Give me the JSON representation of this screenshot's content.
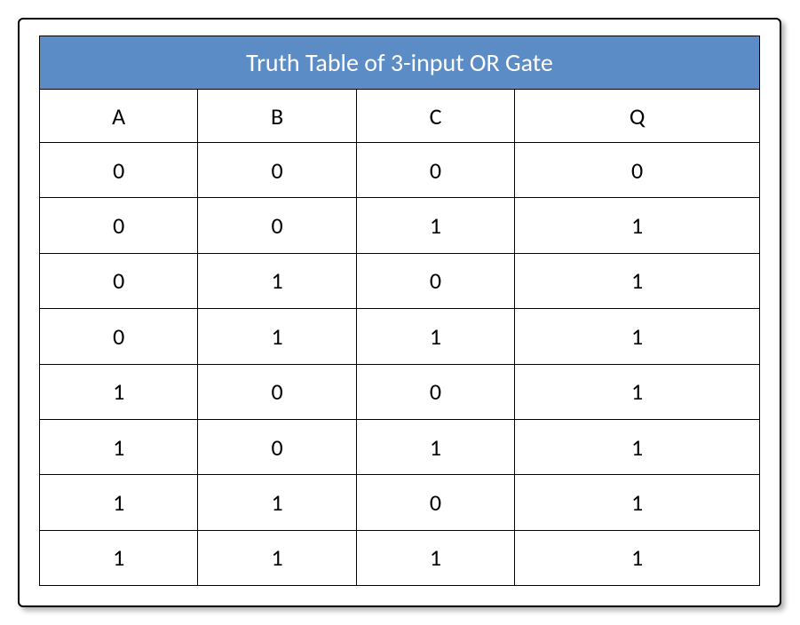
{
  "chart_data": {
    "type": "table",
    "title": "Truth Table of 3-input OR Gate",
    "columns": [
      "A",
      "B",
      "C",
      "Q"
    ],
    "rows": [
      [
        "0",
        "0",
        "0",
        "0"
      ],
      [
        "0",
        "0",
        "1",
        "1"
      ],
      [
        "0",
        "1",
        "0",
        "1"
      ],
      [
        "0",
        "1",
        "1",
        "1"
      ],
      [
        "1",
        "0",
        "0",
        "1"
      ],
      [
        "1",
        "0",
        "1",
        "1"
      ],
      [
        "1",
        "1",
        "0",
        "1"
      ],
      [
        "1",
        "1",
        "1",
        "1"
      ]
    ]
  },
  "colors": {
    "header_bg": "#5b8cc6",
    "header_fg": "#ffffff",
    "border": "#000000"
  }
}
